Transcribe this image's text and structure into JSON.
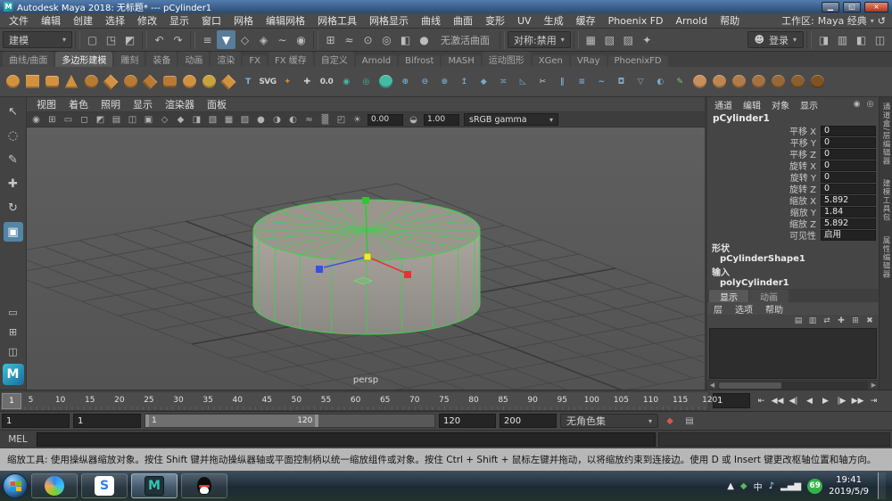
{
  "glyphs": {
    "chevron": "▾",
    "user": "☻",
    "scroll_left": "◀",
    "scroll_right": "▶"
  },
  "window": {
    "app_icon_letter": "M",
    "title": "Autodesk Maya 2018: 无标题* --- pCylinder1",
    "controls": [
      {
        "name": "minimize-button",
        "glyph": "▁"
      },
      {
        "name": "restore-button",
        "glyph": "◱"
      },
      {
        "name": "close-button",
        "glyph": "×",
        "cls": "close"
      }
    ]
  },
  "menu_bar": {
    "items": [
      "文件",
      "编辑",
      "创建",
      "选择",
      "修改",
      "显示",
      "窗口",
      "网格",
      "编辑网格",
      "网格工具",
      "网格显示",
      "曲线",
      "曲面",
      "变形",
      "UV",
      "生成",
      "缓存",
      "Phoenix FD",
      "Arnold",
      "帮助"
    ],
    "workspace_label": "工作区:",
    "workspace_value": "Maya 经典",
    "workspace_reset_glyph": "↺"
  },
  "status_line": {
    "mode": "建模",
    "no_live_surface": "无激活曲面",
    "symmetry": "对称:禁用",
    "login": "登录",
    "file_icons": [
      {
        "name": "new-scene-icon",
        "glyph": "▢"
      },
      {
        "name": "open-scene-icon",
        "glyph": "◳"
      },
      {
        "name": "save-scene-icon",
        "glyph": "◩"
      }
    ],
    "history_icons": [
      {
        "name": "undo-icon",
        "glyph": "↶"
      },
      {
        "name": "redo-icon",
        "glyph": "↷"
      }
    ],
    "mask_icons": [
      {
        "name": "select-hierarchy-icon",
        "glyph": "≡"
      },
      {
        "name": "select-object-icon",
        "glyph": "▼",
        "cls": "active"
      },
      {
        "name": "select-component-icon",
        "glyph": "◇"
      },
      {
        "name": "select-mesh-mask-icon",
        "glyph": "◈"
      },
      {
        "name": "select-nurbs-mask-icon",
        "glyph": "∼"
      },
      {
        "name": "select-rendering-mask-icon",
        "glyph": "◉"
      }
    ],
    "snap_icons": [
      {
        "name": "snap-grid-icon",
        "glyph": "⊞"
      },
      {
        "name": "snap-curve-icon",
        "glyph": "≈"
      },
      {
        "name": "snap-point-icon",
        "glyph": "⊙"
      },
      {
        "name": "snap-projected-center-icon",
        "glyph": "◎"
      },
      {
        "name": "snap-view-plane-icon",
        "glyph": "◧"
      },
      {
        "name": "make-live-icon",
        "glyph": "●"
      }
    ],
    "render_icons": [
      {
        "name": "open-render-view-icon",
        "glyph": "▦"
      },
      {
        "name": "render-current-frame-icon",
        "glyph": "▧"
      },
      {
        "name": "ipr-render-icon",
        "glyph": "▨"
      },
      {
        "name": "render-settings-icon",
        "glyph": "✦"
      }
    ],
    "panel_toggle_icons": [
      {
        "name": "modeling-toolkit-toggle-icon",
        "glyph": "◨"
      },
      {
        "name": "hypershade-toggle-icon",
        "glyph": "▥"
      },
      {
        "name": "attribute-editor-toggle-icon",
        "glyph": "◧"
      },
      {
        "name": "channel-box-toggle-icon",
        "glyph": "◫"
      }
    ]
  },
  "shelf": {
    "tabs": [
      {
        "label": "曲线/曲面"
      },
      {
        "label": "多边形建模",
        "cls": "active"
      },
      {
        "label": "雕刻"
      },
      {
        "label": "装备"
      },
      {
        "label": "动画"
      },
      {
        "label": "渲染"
      },
      {
        "label": "FX"
      },
      {
        "label": "FX 缓存"
      },
      {
        "label": "自定义"
      },
      {
        "label": "Arnold"
      },
      {
        "label": "Bifrost"
      },
      {
        "label": "MASH"
      },
      {
        "label": "运动图形"
      },
      {
        "label": "XGen"
      },
      {
        "label": "VRay"
      },
      {
        "label": "PhoenixFD"
      }
    ],
    "icons": [
      {
        "name": "poly-sphere-icon",
        "shape": "c",
        "bg": "#d3913f"
      },
      {
        "name": "poly-cube-icon",
        "shape": "s",
        "bg": "#d3913f"
      },
      {
        "name": "poly-cylinder-icon",
        "shape": "r",
        "bg": "#d3913f"
      },
      {
        "name": "poly-cone-icon",
        "shape": "t",
        "bg": "#d3913f"
      },
      {
        "name": "poly-torus-icon",
        "shape": "c",
        "bg": "#b87a33"
      },
      {
        "name": "poly-plane-icon",
        "shape": "d",
        "bg": "#d3913f"
      },
      {
        "name": "poly-disc-icon",
        "shape": "c",
        "bg": "#b87a33"
      },
      {
        "name": "platonic-solid-icon",
        "shape": "d",
        "bg": "#b87a33"
      },
      {
        "name": "poly-pipe-icon",
        "shape": "r",
        "bg": "#b87a33"
      },
      {
        "name": "poly-helix-icon",
        "shape": "c",
        "bg": "#d3913f"
      },
      {
        "name": "poly-gear-icon",
        "shape": "c",
        "bg": "#c9a23c"
      },
      {
        "name": "super-shape-icon",
        "shape": "d",
        "bg": "#d3913f"
      },
      {
        "name": "type-tool-icon",
        "shape": "x",
        "fg": "#79b7e2",
        "glyph": "T"
      },
      {
        "name": "svg-tool-icon",
        "shape": "x",
        "fg": "#cfcfcf",
        "glyph": "SVG"
      },
      {
        "name": "sweep-mesh-icon",
        "shape": "x",
        "fg": "#d3913f",
        "glyph": "✦"
      },
      {
        "name": "locator-icon",
        "shape": "x",
        "fg": "#cfcfcf",
        "glyph": "✚"
      },
      {
        "name": "measure-icon",
        "shape": "x",
        "fg": "#cfcfcf",
        "glyph": "0.0"
      },
      {
        "name": "combine-icon",
        "shape": "x",
        "fg": "#43bba4",
        "glyph": "◉"
      },
      {
        "name": "separate-icon",
        "shape": "x",
        "fg": "#43bba4",
        "glyph": "◎"
      },
      {
        "name": "smooth-icon",
        "shape": "c",
        "bg": "#43bba4"
      },
      {
        "name": "boolean-union-icon",
        "shape": "x",
        "fg": "#79a9cc",
        "glyph": "⊕"
      },
      {
        "name": "boolean-difference-icon",
        "shape": "x",
        "fg": "#79a9cc",
        "glyph": "⊖"
      },
      {
        "name": "boolean-intersection-icon",
        "shape": "x",
        "fg": "#79a9cc",
        "glyph": "⊗"
      },
      {
        "name": "extrude-icon",
        "shape": "x",
        "fg": "#79a9cc",
        "glyph": "↥"
      },
      {
        "name": "bevel-icon",
        "shape": "x",
        "fg": "#79a9cc",
        "glyph": "◆"
      },
      {
        "name": "bridge-icon",
        "shape": "x",
        "fg": "#79a9cc",
        "glyph": "≍"
      },
      {
        "name": "append-polygon-icon",
        "shape": "x",
        "fg": "#79a9cc",
        "glyph": "◺"
      },
      {
        "name": "multi-cut-icon",
        "shape": "x",
        "fg": "#cfcfcf",
        "glyph": "✂"
      },
      {
        "name": "insert-edge-loop-icon",
        "shape": "x",
        "fg": "#79a9cc",
        "glyph": "∥"
      },
      {
        "name": "offset-edge-loop-icon",
        "shape": "x",
        "fg": "#79a9cc",
        "glyph": "≡"
      },
      {
        "name": "edit-edge-flow-icon",
        "shape": "x",
        "fg": "#79a9cc",
        "glyph": "∼"
      },
      {
        "name": "fill-hole-icon",
        "shape": "x",
        "fg": "#79a9cc",
        "glyph": "◘"
      },
      {
        "name": "reduce-icon",
        "shape": "x",
        "fg": "#79a9cc",
        "glyph": "▽"
      },
      {
        "name": "mirror-icon",
        "shape": "x",
        "fg": "#79a9cc",
        "glyph": "◐"
      },
      {
        "name": "quad-draw-icon",
        "shape": "x",
        "fg": "#7cc67c",
        "glyph": "✎"
      },
      {
        "name": "sculpt-tool-icon",
        "shape": "c",
        "bg": "#c98f5a"
      },
      {
        "name": "smooth-sculpt-icon",
        "shape": "c",
        "bg": "#bd8550"
      },
      {
        "name": "relax-sculpt-icon",
        "shape": "c",
        "bg": "#b17b47"
      },
      {
        "name": "grab-sculpt-icon",
        "shape": "c",
        "bg": "#a5713e"
      },
      {
        "name": "pinch-sculpt-icon",
        "shape": "c",
        "bg": "#996735"
      },
      {
        "name": "flatten-sculpt-icon",
        "shape": "c",
        "bg": "#8d5d2c"
      },
      {
        "name": "bulge-sculpt-icon",
        "shape": "c",
        "bg": "#815323"
      }
    ]
  },
  "toolbox": {
    "logo": "M",
    "tools": [
      {
        "name": "select-tool-icon",
        "glyph": "↖"
      },
      {
        "name": "lasso-tool-icon",
        "glyph": "◌"
      },
      {
        "name": "paint-select-tool-icon",
        "glyph": "✎"
      },
      {
        "name": "move-tool-icon",
        "glyph": "✚"
      },
      {
        "name": "rotate-tool-icon",
        "glyph": "↻"
      },
      {
        "name": "scale-tool-icon",
        "glyph": "▣",
        "cls": "active"
      }
    ],
    "layouts": [
      {
        "name": "single-pane-layout-icon",
        "glyph": "▭"
      },
      {
        "name": "four-pane-layout-icon",
        "glyph": "⊞"
      },
      {
        "name": "persp-outliner-layout-icon",
        "glyph": "◫"
      }
    ]
  },
  "viewport": {
    "menus": [
      "视图",
      "着色",
      "照明",
      "显示",
      "渲染器",
      "面板"
    ],
    "toolbar_icons": [
      {
        "name": "renderer-settings-icon",
        "glyph": "◉"
      },
      {
        "name": "grid-toggle-icon",
        "glyph": "⊞"
      },
      {
        "name": "film-gate-icon",
        "glyph": "▭"
      },
      {
        "name": "resolution-gate-icon",
        "glyph": "◻"
      },
      {
        "name": "gate-mask-icon",
        "glyph": "◩"
      },
      {
        "name": "field-chart-icon",
        "glyph": "▤"
      },
      {
        "name": "safe-action-icon",
        "glyph": "◫"
      },
      {
        "name": "safe-title-icon",
        "glyph": "▣"
      },
      {
        "name": "frame-all-icon",
        "glyph": "◇"
      },
      {
        "name": "frame-selection-icon",
        "glyph": "◆"
      },
      {
        "name": "isolate-select-icon",
        "glyph": "◨"
      },
      {
        "name": "xray-icon",
        "glyph": "▧"
      },
      {
        "name": "wireframe-on-shaded-icon",
        "glyph": "▦"
      },
      {
        "name": "textured-display-icon",
        "glyph": "▨"
      },
      {
        "name": "use-default-material-icon",
        "glyph": "●"
      },
      {
        "name": "shadows-display-icon",
        "glyph": "◑"
      },
      {
        "name": "ambient-occlusion-icon",
        "glyph": "◐"
      },
      {
        "name": "motion-blur-icon",
        "glyph": "≈"
      },
      {
        "name": "fog-display-icon",
        "glyph": "▒"
      },
      {
        "name": "gpu-cache-icon",
        "glyph": "◰"
      }
    ],
    "exposure_glyph": "☀",
    "contrast_glyph": "◒",
    "exposure_value": "0.00",
    "gamma_value": "1.00",
    "view_transform": "sRGB gamma",
    "camera_label": "persp"
  },
  "channel_box": {
    "menus": [
      "通道",
      "编辑",
      "对象",
      "显示"
    ],
    "corner_icons": [
      {
        "name": "channel-speed-icon",
        "glyph": "◉"
      },
      {
        "name": "channel-hyperbolic-icon",
        "glyph": "◎"
      }
    ],
    "object_name": "pCylinder1",
    "attributes": [
      {
        "label": "平移 X",
        "value": "0"
      },
      {
        "label": "平移 Y",
        "value": "0"
      },
      {
        "label": "平移 Z",
        "value": "0"
      },
      {
        "label": "旋转 X",
        "value": "0"
      },
      {
        "label": "旋转 Y",
        "value": "0"
      },
      {
        "label": "旋转 Z",
        "value": "0"
      },
      {
        "label": "缩放 X",
        "value": "5.892"
      },
      {
        "label": "缩放 Y",
        "value": "1.84"
      },
      {
        "label": "缩放 Z",
        "value": "5.892"
      },
      {
        "label": "可见性",
        "value": "启用"
      }
    ],
    "shapes_header": "形状",
    "shape_name": "pCylinderShape1",
    "inputs_header": "输入",
    "input_node": "polyCylinder1"
  },
  "layer_editor": {
    "tabs": [
      {
        "label": "显示",
        "cls": "active"
      },
      {
        "label": "动画"
      }
    ],
    "menus": [
      "层",
      "选项",
      "帮助"
    ],
    "icons": [
      {
        "name": "layer-normal-mode-icon",
        "glyph": "▤"
      },
      {
        "name": "layer-playback-mode-icon",
        "glyph": "▥"
      },
      {
        "name": "layer-transfer-icon",
        "glyph": "⇄"
      },
      {
        "name": "create-empty-layer-icon",
        "glyph": "✚"
      },
      {
        "name": "create-layer-from-selected-icon",
        "glyph": "⊞"
      },
      {
        "name": "delete-layer-icon",
        "glyph": "✖"
      }
    ]
  },
  "side_tabs": [
    "通道盒/层编辑器",
    "建模工具包",
    "属性编辑器"
  ],
  "time_slider": {
    "current_frame": "1",
    "ticks": [
      "5",
      "10",
      "15",
      "20",
      "25",
      "30",
      "35",
      "40",
      "45",
      "50",
      "55",
      "60",
      "65",
      "70",
      "75",
      "80",
      "85",
      "90",
      "95",
      "100",
      "105",
      "110",
      "115",
      "120"
    ],
    "playback": [
      {
        "name": "go-to-start-button",
        "glyph": "⇤"
      },
      {
        "name": "step-back-key-button",
        "glyph": "◀◀"
      },
      {
        "name": "step-back-frame-button",
        "glyph": "◀|"
      },
      {
        "name": "play-backward-button",
        "glyph": "◀"
      },
      {
        "name": "play-forward-button",
        "glyph": "▶"
      },
      {
        "name": "step-forward-frame-button",
        "glyph": "|▶"
      },
      {
        "name": "step-forward-key-button",
        "glyph": "▶▶"
      },
      {
        "name": "go-to-end-button",
        "glyph": "⇥"
      }
    ]
  },
  "range_slider": {
    "anim_start": "1",
    "play_start": "1",
    "range_start_label": "1",
    "range_end_label": "120",
    "play_end": "120",
    "anim_end": "200",
    "character_set": "无角色集",
    "icons": [
      {
        "name": "auto-keyframe-icon",
        "glyph": "◆",
        "fg": "#cf5b4c"
      },
      {
        "name": "animation-preferences-icon",
        "glyph": "▤"
      }
    ]
  },
  "command_line": {
    "label": "MEL"
  },
  "help_line": {
    "text": "缩放工具: 使用操纵器缩放对象。按住 Shift 键并拖动操纵器轴或平面控制柄以统一缩放组件或对象。按住 Ctrl + Shift + 鼠标左键并拖动，以将缩放约束到连接边。使用 D 或 Insert 键更改枢轴位置和轴方向。"
  },
  "taskbar": {
    "sogou_letter": "S",
    "maya_letter": "M",
    "badge": "69",
    "time": "19:41",
    "date": "2019/5/9",
    "tray_icons": [
      {
        "name": "tray-expand-icon",
        "glyph": "▲"
      },
      {
        "name": "tray-security-icon",
        "glyph": "◆",
        "fg": "#58b957"
      },
      {
        "name": "tray-input-method-icon",
        "glyph": "中"
      },
      {
        "name": "tray-volume-icon",
        "glyph": "♪"
      },
      {
        "name": "tray-network-icon",
        "glyph": "▂▄▆"
      }
    ]
  }
}
